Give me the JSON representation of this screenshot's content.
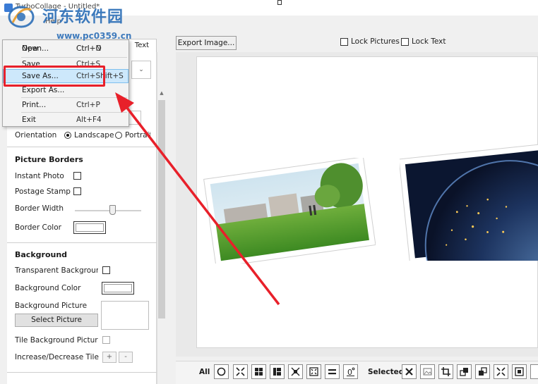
{
  "window": {
    "title": "TurboCollage - Untitled*"
  },
  "watermark": {
    "site_name": "河东软件园",
    "url": "www.pc0359.cn"
  },
  "menu_bar": {
    "help_label": "Help"
  },
  "file_menu": {
    "items": [
      {
        "label": "New",
        "shortcut": "Ctrl+N"
      },
      {
        "label": "Open...",
        "shortcut": "Ctrl+O"
      },
      {
        "label": "Save",
        "shortcut": "Ctrl+S"
      },
      {
        "label": "Save As...",
        "shortcut": "Ctrl+Shift+S"
      },
      {
        "label": "Export As...",
        "shortcut": ""
      },
      {
        "label": "Print...",
        "shortcut": "Ctrl+P"
      },
      {
        "label": "Exit",
        "shortcut": "Alt+F4"
      }
    ]
  },
  "left_tabs": {
    "text_tab": "Text"
  },
  "layout": {
    "orientation_label": "Orientation",
    "landscape_label": "Landscape",
    "portrait_label": "Portrait",
    "selected": "Landscape"
  },
  "picture_borders": {
    "title": "Picture Borders",
    "instant_photo": "Instant Photo",
    "postage_stamp": "Postage Stamp",
    "border_width": "Border Width",
    "border_color": "Border Color",
    "border_color_value": "#ffffff"
  },
  "background": {
    "title": "Background",
    "transparent": "Transparent Backgrour",
    "bg_color": "Background Color",
    "bg_color_value": "#ffffff",
    "bg_picture": "Background Picture",
    "select_picture_btn": "Select Picture",
    "tile": "Tile Background Pictur",
    "inc_dec_tile": "Increase/Decrease Tile",
    "plus": "+",
    "minus": "-"
  },
  "toolbar": {
    "export_image": "Export Image...",
    "lock_pictures": "Lock Pictures",
    "lock_text": "Lock Text"
  },
  "bottom_toolbar": {
    "all_label": "All",
    "selected_label": "Selected",
    "all_icons": [
      "shuffle-circle-icon",
      "fit-expand-icon",
      "grid-2x2-icon",
      "grid-layout-icon",
      "compact-icon",
      "spread-icon",
      "align-equal-icon",
      "rotate-zero-icon"
    ],
    "selected_icons": [
      "delete-icon",
      "replace-image-icon",
      "crop-icon",
      "bring-front-icon",
      "send-back-icon",
      "expand-icon",
      "shrink-icon",
      "more-icon"
    ]
  },
  "colors": {
    "accent": "#2d6fb7",
    "annotation": "#e8202a",
    "menu_highlight": "#cde8fb"
  }
}
